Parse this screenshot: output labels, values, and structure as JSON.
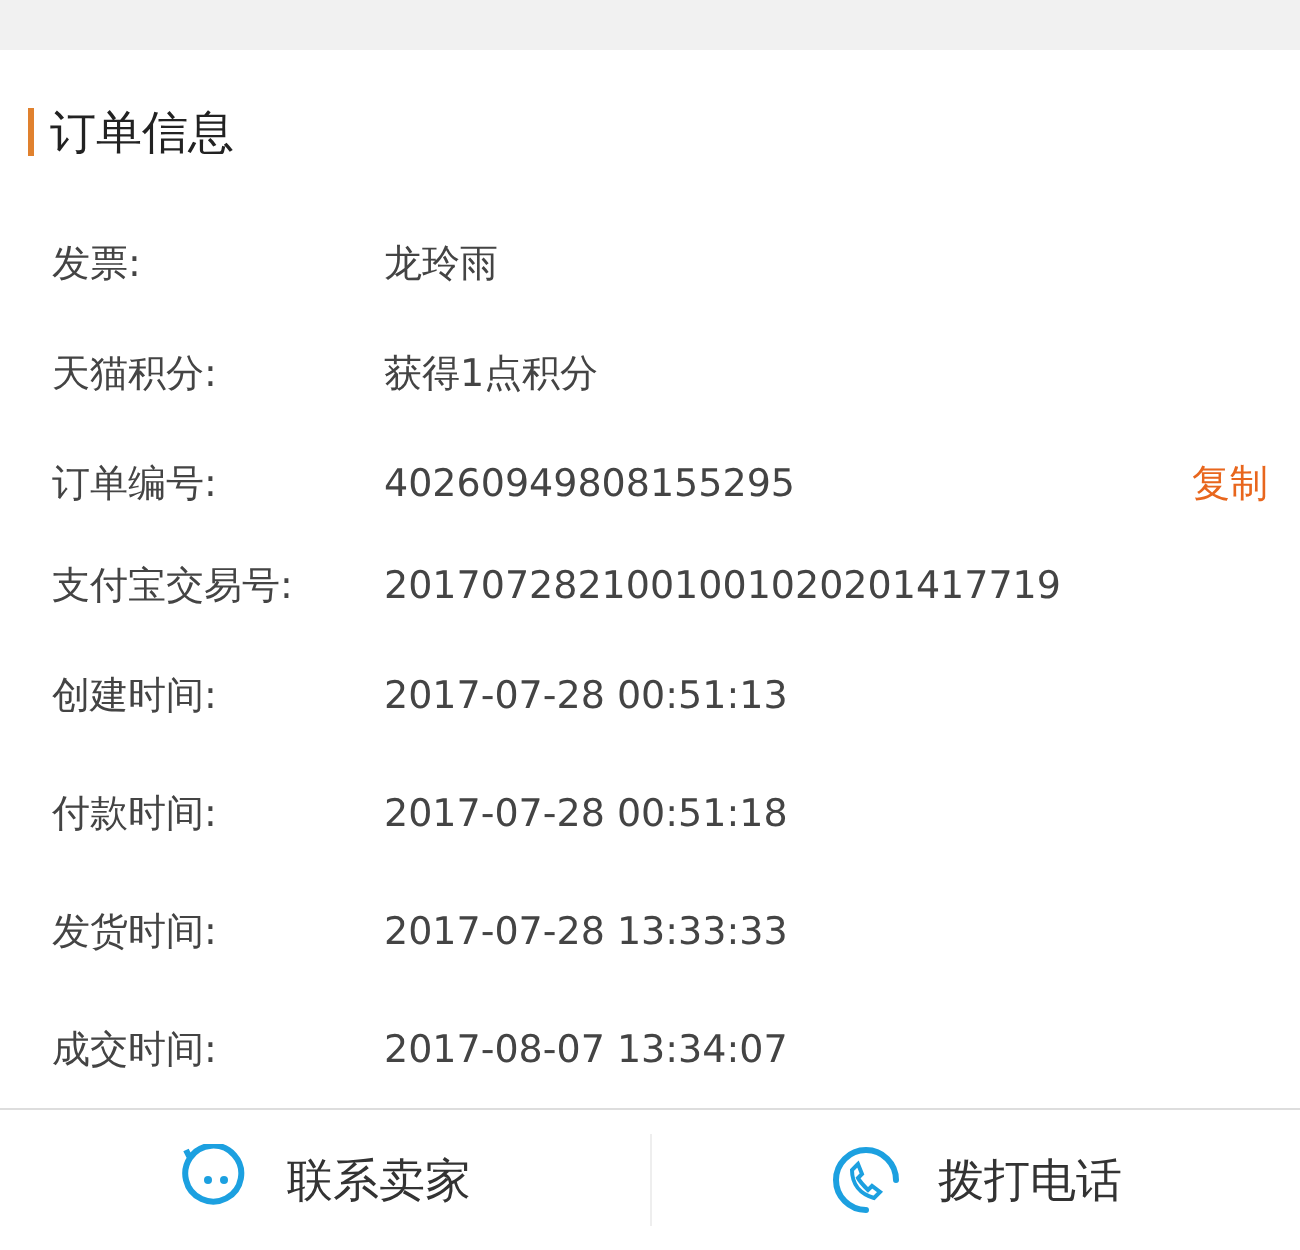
{
  "section": {
    "title": "订单信息"
  },
  "rows": [
    {
      "label": "发票:",
      "value": "龙玲雨"
    },
    {
      "label": "天猫积分:",
      "value": "获得1点积分"
    },
    {
      "label": "订单编号:",
      "value": "40260949808155295",
      "action": "复制"
    },
    {
      "label": "支付宝交易号:",
      "value": "2017072821001001020201417719"
    },
    {
      "label": "创建时间:",
      "value": "2017-07-28 00:51:13"
    },
    {
      "label": "付款时间:",
      "value": "2017-07-28 00:51:18"
    },
    {
      "label": "发货时间:",
      "value": "2017-07-28 13:33:33"
    },
    {
      "label": "成交时间:",
      "value": "2017-08-07 13:34:07"
    }
  ],
  "actions": [
    {
      "kind": "chat",
      "label": "联系卖家"
    },
    {
      "kind": "phone",
      "label": "拨打电话"
    }
  ]
}
